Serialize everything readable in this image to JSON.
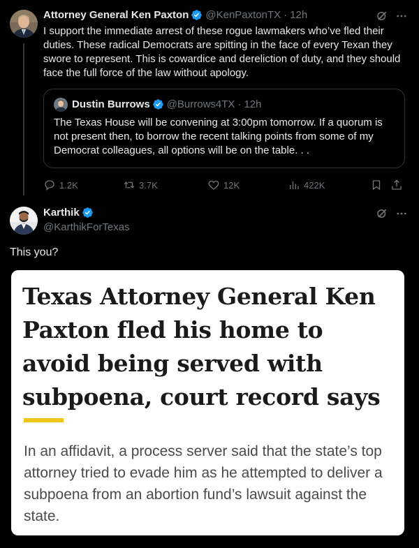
{
  "tweet_main": {
    "author_name": "Attorney General Ken Paxton",
    "handle": "@KenPaxtonTX",
    "separator": "·",
    "time": "12h",
    "text": "I support the immediate arrest of these rogue lawmakers who’ve fled their duties. These radical Democrats are spitting in the face of every Texan they swore to represent. This is cowardice and dereliction of duty, and they should face the full force of the law without apology."
  },
  "quoted_tweet": {
    "author_name": "Dustin Burrows",
    "handle": "@Burrows4TX",
    "separator": "·",
    "time": "12h",
    "text": "The Texas House will be convening at 3:00pm tomorrow. If a quorum is not present then, to borrow the recent talking points from some of my Democrat colleagues, all options will be on the table. . ."
  },
  "actions": {
    "replies": "1.2K",
    "reposts": "3.7K",
    "likes": "12K",
    "views": "422K"
  },
  "reply_tweet": {
    "author_name": "Karthik",
    "handle": "@KarthikForTexas",
    "text": "This you?"
  },
  "article_card": {
    "headline": "Texas Attorney General Ken Paxton fled his home to avoid being served with subpoena, court record says",
    "accent_color": "#f2c318",
    "summary": "In an affidavit, a process server said that the state’s top attorney tried to evade him as he attempted to deliver a subpoena from an abortion fund’s lawsuit against the state."
  },
  "colors": {
    "background": "#000000",
    "verified": "#1d9bf0",
    "secondary_text": "#71767b"
  },
  "icons": [
    "verified-badge-icon",
    "grok-icon",
    "more-icon",
    "reply-icon",
    "repost-icon",
    "like-icon",
    "views-icon",
    "bookmark-icon",
    "share-icon"
  ]
}
